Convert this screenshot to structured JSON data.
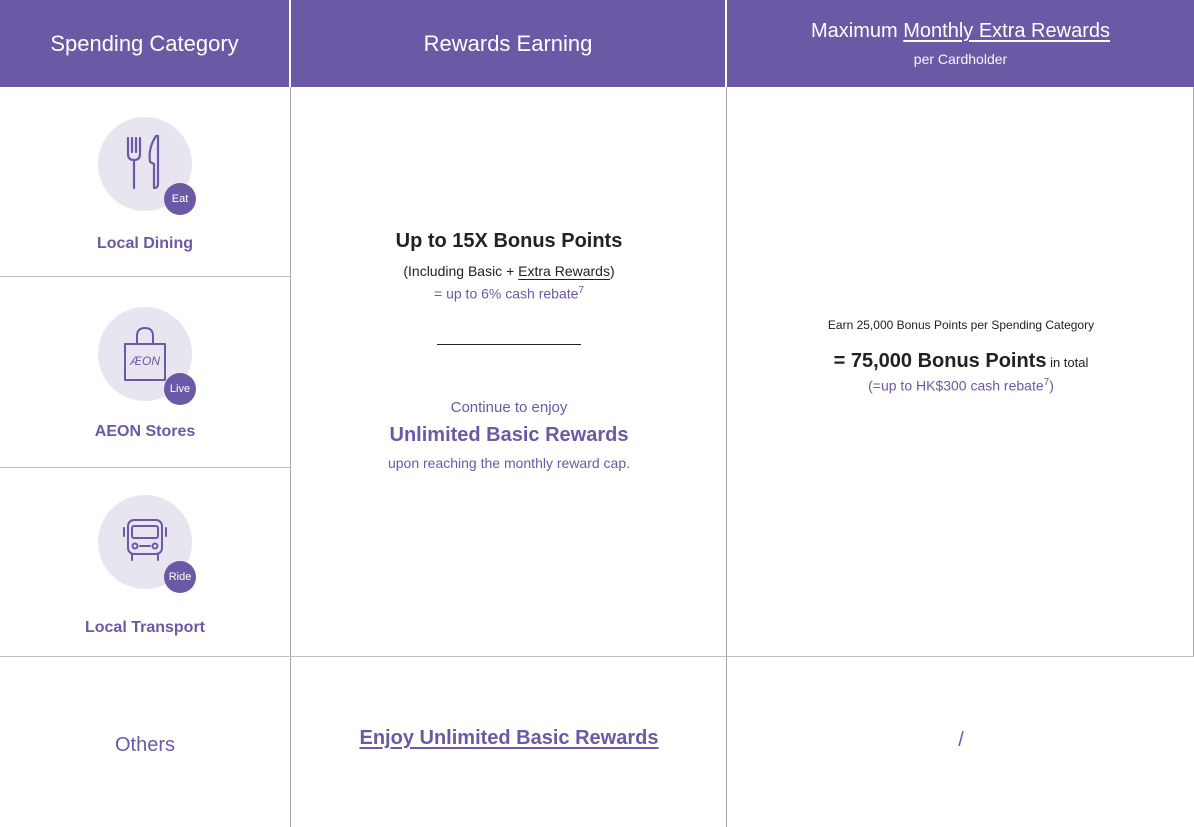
{
  "header": {
    "spending_category": "Spending Category",
    "rewards_earning": "Rewards Earning",
    "max_title_prefix": "Maximum ",
    "max_title_link": "Monthly Extra Rewards",
    "max_subtitle": "per Cardholder"
  },
  "categories": [
    {
      "label": "Local Dining",
      "badge": "Eat",
      "icon": "fork-knife-icon"
    },
    {
      "label": "AEON Stores",
      "badge": "Live",
      "icon": "shopping-bag-icon"
    },
    {
      "label": "Local Transport",
      "badge": "Ride",
      "icon": "bus-icon"
    }
  ],
  "aeon_logo_text": "ÆON",
  "rewards": {
    "headline": "Up to 15X Bonus Points",
    "including_prefix": "(Including Basic + ",
    "including_link": "Extra Rewards",
    "including_suffix": ")",
    "cash_rebate": "= up to 6% cash rebate",
    "footnote": "7",
    "continue": "Continue to enjoy",
    "unlimited": "Unlimited Basic Rewards",
    "upon": "upon reaching the monthly reward cap."
  },
  "maximum": {
    "earn_text": "Earn 25,000 Bonus Points per Spending Category",
    "total_main": "= 75,000 Bonus Points",
    "total_suffix": " in total",
    "rebate": "(=up to HK$300 cash rebate",
    "footnote": "7",
    "rebate_close": ")"
  },
  "others": {
    "label": "Others",
    "rewards_link": "Enjoy Unlimited Basic Rewards",
    "maximum": "/"
  },
  "colors": {
    "accent": "#6c59a6",
    "circle_bg": "#e8e5f0"
  }
}
